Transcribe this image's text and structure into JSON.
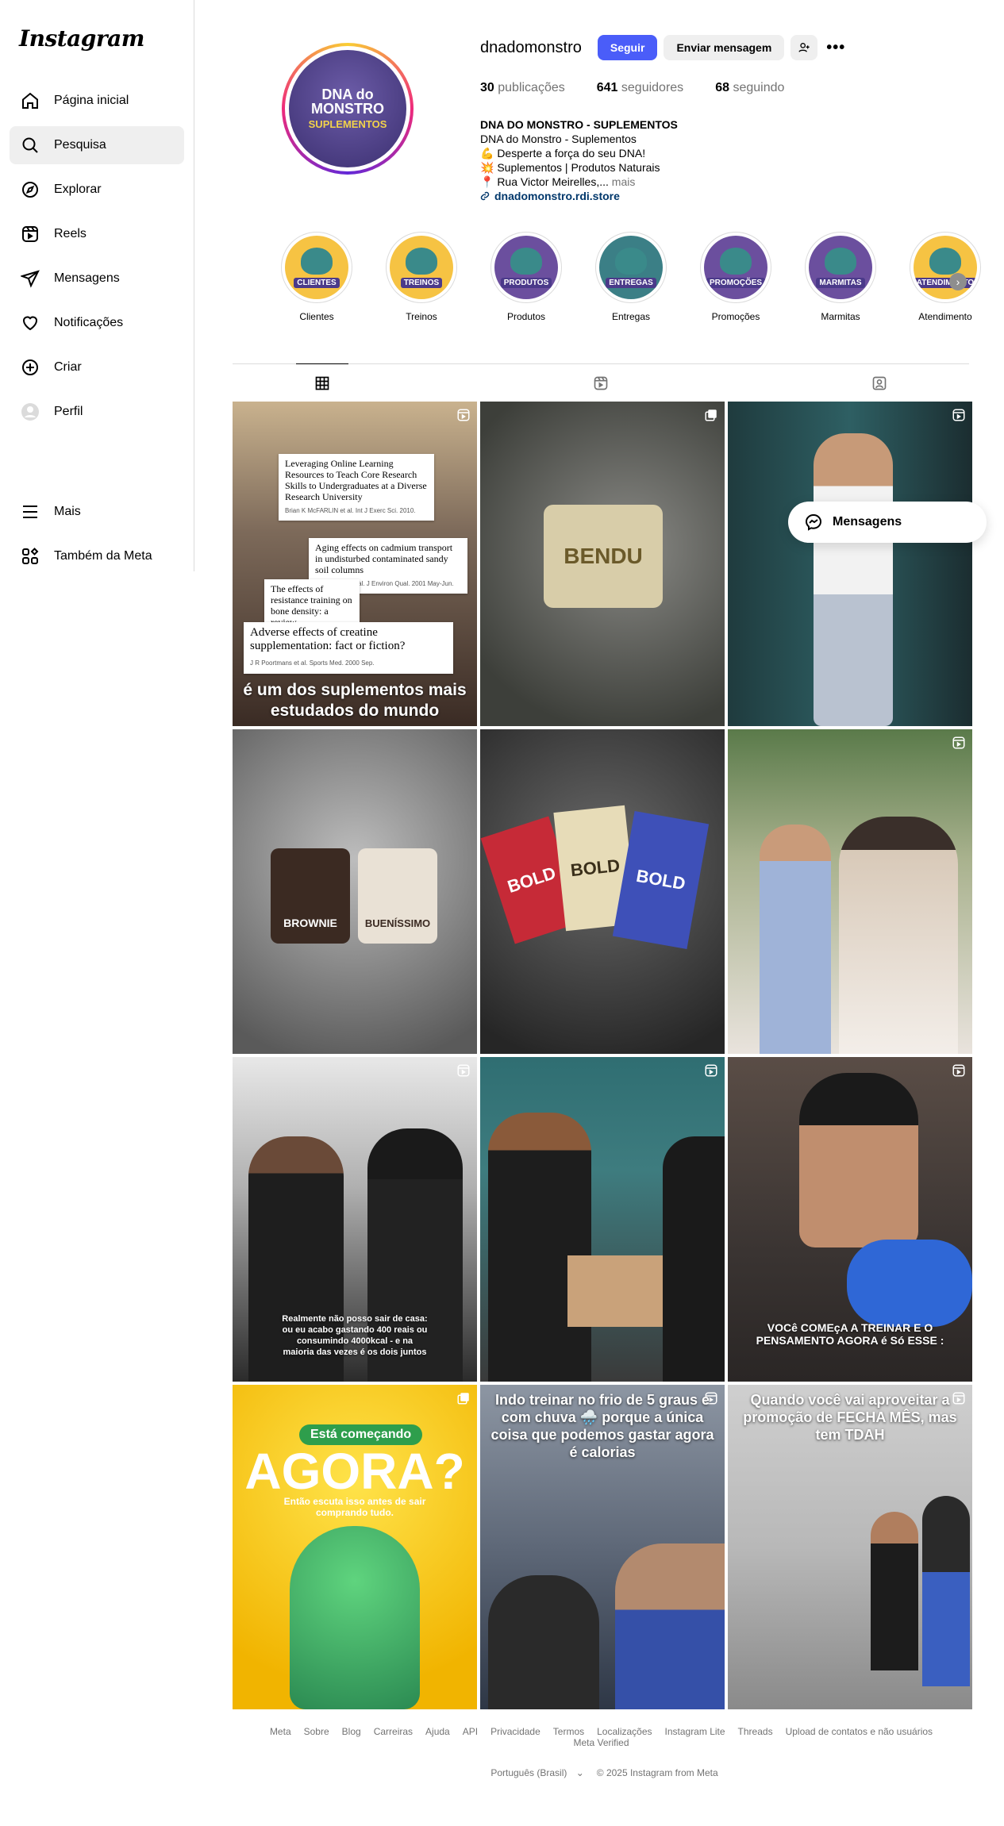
{
  "app": {
    "logo": "Instagram"
  },
  "sidebar": {
    "items": [
      {
        "label": "Página inicial",
        "icon": "home-icon"
      },
      {
        "label": "Pesquisa",
        "icon": "search-icon"
      },
      {
        "label": "Explorar",
        "icon": "compass-icon"
      },
      {
        "label": "Reels",
        "icon": "reels-icon"
      },
      {
        "label": "Mensagens",
        "icon": "send-icon"
      },
      {
        "label": "Notificações",
        "icon": "heart-icon"
      },
      {
        "label": "Criar",
        "icon": "plus-square-icon"
      },
      {
        "label": "Perfil",
        "icon": "avatar-icon"
      }
    ],
    "bottom": [
      {
        "label": "Mais",
        "icon": "menu-icon"
      },
      {
        "label": "Também da Meta",
        "icon": "meta-grid-icon"
      }
    ]
  },
  "profile": {
    "username": "dnadomonstro",
    "follow_label": "Seguir",
    "message_label": "Enviar mensagem",
    "avatar_brand": "DNA do MONSTRO",
    "avatar_sub": "SUPLEMENTOS",
    "stats": {
      "posts_count": "30",
      "posts_label": "publicações",
      "followers_count": "641",
      "followers_label": "seguidores",
      "following_count": "68",
      "following_label": "seguindo"
    },
    "bio": {
      "name": "DNA DO MONSTRO - SUPLEMENTOS",
      "line1": "DNA do Monstro - Suplementos",
      "line2": "💪 Desperte a força do seu DNA!",
      "line3": "💥 Suplementos | Produtos Naturais",
      "line4": "📍 Rua Victor Meirelles,...",
      "more": "mais",
      "link": "dnadomonstro.rdi.store"
    }
  },
  "highlights": [
    {
      "label": "Clientes",
      "badge": "CLIENTES",
      "bg": "#f6c343"
    },
    {
      "label": "Treinos",
      "badge": "TREINOS",
      "bg": "#f6c343"
    },
    {
      "label": "Produtos",
      "badge": "PRODUTOS",
      "bg": "#6b4f9e"
    },
    {
      "label": "Entregas",
      "badge": "ENTREGAS",
      "bg": "#3b7f86"
    },
    {
      "label": "Promoções",
      "badge": "PROMOÇÕES",
      "bg": "#6b4f9e"
    },
    {
      "label": "Marmitas",
      "badge": "MARMITAS",
      "bg": "#6b4f9e"
    },
    {
      "label": "Atendimento",
      "badge": "ATENDIMENTO",
      "bg": "#f6c343"
    }
  ],
  "posts": {
    "p1": {
      "card1_title": "Leveraging Online Learning Resources to Teach Core Research Skills to Undergraduates at a Diverse Research University",
      "card1_auth": "Brian K McFARLIN et al. Int J Exerc Sci. 2010.",
      "card2_title": "Aging effects on cadmium transport in undisturbed contaminated sandy soil columns",
      "card2_auth": "P Seuntjens et al. J Environ Qual. 2001 May-Jun.",
      "card3_title": "The effects of resistance training on bone density: a review",
      "card4_title": "Adverse effects of creatine supplementation: fact or fiction?",
      "card4_auth": "J R Poortmans et al. Sports Med. 2000 Sep.",
      "caption": "é um dos suplementos mais estudados do mundo"
    },
    "p2": {
      "label": "BENDU"
    },
    "p5": {
      "label": "BOLD"
    },
    "p4": {
      "label1": "BROWNIE",
      "label2": "BUENÍSSIMO"
    },
    "p7": {
      "caption": "Realmente não posso sair de casa: ou eu acabo gastando 400 reais ou consumindo 4000kcal - e na maioria das vezes é os dois juntos"
    },
    "p9": {
      "caption": "VOCê COMEçA A TREINAR E O PENSAMENTO AGORA é Só ESSE :"
    },
    "p10": {
      "pill": "Está começando",
      "big": "AGORA?",
      "sub": "Então escuta isso antes de sair comprando tudo."
    },
    "p11": {
      "caption": "Indo treinar no frio de 5 graus e com chuva 🌧️ porque a única coisa que podemos gastar agora é calorias"
    },
    "p12": {
      "caption": "Quando você vai aproveitar a promoção de FECHA MÊS, mas tem TDAH"
    }
  },
  "floating": {
    "messages_label": "Mensagens"
  },
  "footer": {
    "links": [
      "Meta",
      "Sobre",
      "Blog",
      "Carreiras",
      "Ajuda",
      "API",
      "Privacidade",
      "Termos",
      "Localizações",
      "Instagram Lite",
      "Threads",
      "Upload de contatos e não usuários",
      "Meta Verified"
    ],
    "language": "Português (Brasil)",
    "copyright": "© 2025 Instagram from Meta"
  }
}
